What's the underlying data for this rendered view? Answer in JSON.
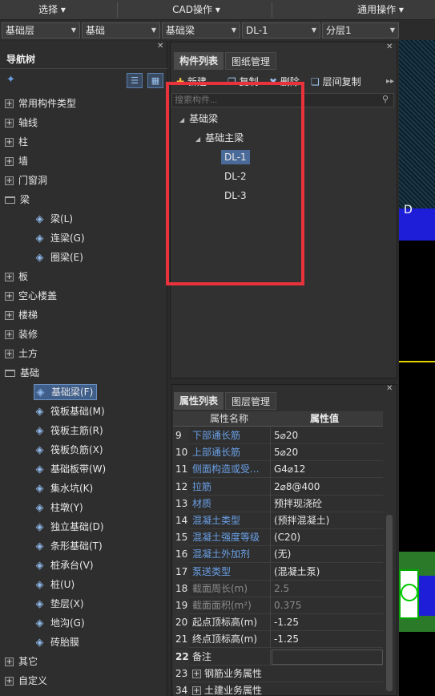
{
  "top_menu": {
    "select": "选择",
    "cad_ops": "CAD操作",
    "general_ops": "通用操作"
  },
  "dropdowns": [
    {
      "value": "基础层"
    },
    {
      "value": "基础"
    },
    {
      "value": "基础梁"
    },
    {
      "value": "DL-1"
    },
    {
      "value": "分层1"
    }
  ],
  "nav": {
    "title": "导航树",
    "items": [
      {
        "label": "常用构件类型",
        "kind": "plus"
      },
      {
        "label": "轴线",
        "kind": "plus"
      },
      {
        "label": "柱",
        "kind": "plus"
      },
      {
        "label": "墙",
        "kind": "plus"
      },
      {
        "label": "门窗洞",
        "kind": "plus"
      },
      {
        "label": "梁",
        "kind": "folder"
      },
      {
        "label": "梁(L)",
        "kind": "child",
        "icon": "beam-icon"
      },
      {
        "label": "连梁(G)",
        "kind": "child",
        "icon": "coupling-beam-icon"
      },
      {
        "label": "圈梁(E)",
        "kind": "child",
        "icon": "ring-beam-icon"
      },
      {
        "label": "板",
        "kind": "plus"
      },
      {
        "label": "空心楼盖",
        "kind": "plus"
      },
      {
        "label": "楼梯",
        "kind": "plus"
      },
      {
        "label": "装修",
        "kind": "plus"
      },
      {
        "label": "土方",
        "kind": "plus"
      },
      {
        "label": "基础",
        "kind": "folder"
      },
      {
        "label": "基础梁(F)",
        "kind": "child",
        "icon": "foundation-beam-icon",
        "selected": true
      },
      {
        "label": "筏板基础(M)",
        "kind": "child",
        "icon": "raft-foundation-icon"
      },
      {
        "label": "筏板主筋(R)",
        "kind": "child",
        "icon": "raft-main-rebar-icon"
      },
      {
        "label": "筏板负筋(X)",
        "kind": "child",
        "icon": "raft-negative-rebar-icon"
      },
      {
        "label": "基础板带(W)",
        "kind": "child",
        "icon": "foundation-strip-icon"
      },
      {
        "label": "集水坑(K)",
        "kind": "child",
        "icon": "sump-pit-icon"
      },
      {
        "label": "柱墩(Y)",
        "kind": "child",
        "icon": "column-pier-icon"
      },
      {
        "label": "独立基础(D)",
        "kind": "child",
        "icon": "isolated-footing-icon"
      },
      {
        "label": "条形基础(T)",
        "kind": "child",
        "icon": "strip-footing-icon"
      },
      {
        "label": "桩承台(V)",
        "kind": "child",
        "icon": "pile-cap-icon"
      },
      {
        "label": "桩(U)",
        "kind": "child",
        "icon": "pile-icon"
      },
      {
        "label": "垫层(X)",
        "kind": "child",
        "icon": "cushion-layer-icon"
      },
      {
        "label": "地沟(G)",
        "kind": "child",
        "icon": "trench-icon"
      },
      {
        "label": "砖胎膜",
        "kind": "child",
        "icon": "brick-mold-icon"
      },
      {
        "label": "其它",
        "kind": "plus"
      },
      {
        "label": "自定义",
        "kind": "plus"
      }
    ]
  },
  "component_panel": {
    "tabs": [
      "构件列表",
      "图纸管理"
    ],
    "toolbar": {
      "new": "新建",
      "copy": "复制",
      "delete": "删除",
      "floor_copy": "层间复制"
    },
    "search_placeholder": "搜索构件...",
    "tree": {
      "root": "基础梁",
      "group": "基础主梁",
      "items": [
        "DL-1",
        "DL-2",
        "DL-3"
      ]
    }
  },
  "property_panel": {
    "tabs": [
      "属性列表",
      "图层管理"
    ],
    "columns": {
      "name": "属性名称",
      "value": "属性值"
    },
    "rows": [
      {
        "num": "9",
        "name": "下部通长筋",
        "value": "5⌀20",
        "style": "blue"
      },
      {
        "num": "10",
        "name": "上部通长筋",
        "value": "5⌀20",
        "style": "blue"
      },
      {
        "num": "11",
        "name": "侧面构造或受...",
        "value": "G4⌀12",
        "style": "blue"
      },
      {
        "num": "12",
        "name": "拉筋",
        "value": "2⌀8@400",
        "style": "blue"
      },
      {
        "num": "13",
        "name": "材质",
        "value": "预拌现浇砼",
        "style": "blue"
      },
      {
        "num": "14",
        "name": "混凝土类型",
        "value": "(预拌混凝土)",
        "style": "blue"
      },
      {
        "num": "15",
        "name": "混凝土强度等级",
        "value": "(C20)",
        "style": "blue"
      },
      {
        "num": "16",
        "name": "混凝土外加剂",
        "value": "(无)",
        "style": "blue"
      },
      {
        "num": "17",
        "name": "泵送类型",
        "value": "(混凝土泵)",
        "style": "blue"
      },
      {
        "num": "18",
        "name": "截面周长(m)",
        "value": "2.5",
        "style": "grey"
      },
      {
        "num": "19",
        "name": "截面面积(m²)",
        "value": "0.375",
        "style": "grey"
      },
      {
        "num": "20",
        "name": "起点顶标高(m)",
        "value": "-1.25",
        "style": "normal"
      },
      {
        "num": "21",
        "name": "终点顶标高(m)",
        "value": "-1.25",
        "style": "normal"
      },
      {
        "num": "22",
        "name": "备注",
        "value": "",
        "style": "normal"
      },
      {
        "num": "23",
        "name": "钢筋业务属性",
        "value": "",
        "style": "group"
      },
      {
        "num": "34",
        "name": "土建业务属性",
        "value": "",
        "style": "group"
      }
    ]
  },
  "colors": {
    "selection": "#3f5f8a",
    "highlight_box": "#e8323c",
    "blue_text": "#6aa0e6"
  }
}
